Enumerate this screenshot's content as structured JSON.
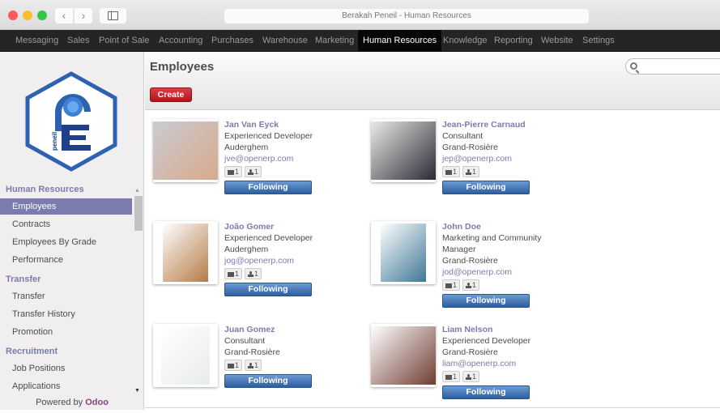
{
  "window": {
    "title": "Berakah Peneil - Human Resources",
    "back_glyph": "‹",
    "forward_glyph": "›"
  },
  "topmenu": {
    "items": [
      {
        "label": "Messaging"
      },
      {
        "label": "Sales"
      },
      {
        "label": "Point of Sale"
      },
      {
        "label": "Accounting"
      },
      {
        "label": "Purchases"
      },
      {
        "label": "Warehouse"
      },
      {
        "label": "Marketing"
      },
      {
        "label": "Human Resources",
        "active": true
      },
      {
        "label": "Knowledge"
      },
      {
        "label": "Reporting"
      },
      {
        "label": "Website"
      },
      {
        "label": "Settings"
      }
    ]
  },
  "sidebar": {
    "logo_text": "peneil",
    "sections": [
      {
        "title": "Human Resources",
        "items": [
          {
            "label": "Employees",
            "active": true
          },
          {
            "label": "Contracts"
          },
          {
            "label": "Employees By Grade"
          },
          {
            "label": "Performance"
          }
        ]
      },
      {
        "title": "Transfer",
        "items": [
          {
            "label": "Transfer"
          },
          {
            "label": "Transfer History"
          },
          {
            "label": "Promotion"
          }
        ]
      },
      {
        "title": "Recruitment",
        "items": [
          {
            "label": "Job Positions"
          },
          {
            "label": "Applications"
          }
        ]
      }
    ],
    "powered_by": "Powered by",
    "powered_brand": "Odoo",
    "scroll_up": "▲",
    "scroll_down": "▼"
  },
  "main": {
    "title": "Employees",
    "create_label": "Create",
    "search_placeholder": ""
  },
  "employees": [
    {
      "name": "Jan Van Eyck",
      "job": "Experienced Developer",
      "location": "Auderghem",
      "email": "jve@openerp.com",
      "messages": "1",
      "followers": "1",
      "follow_label": "Following"
    },
    {
      "name": "Jean-Pierre Carnaud",
      "job": "Consultant",
      "location": "Grand-Rosière",
      "email": "jep@openerp.com",
      "messages": "1",
      "followers": "1",
      "follow_label": "Following"
    },
    {
      "name": "João Gomer",
      "job": "Experienced Developer",
      "location": "Auderghem",
      "email": "jog@openerp.com",
      "messages": "1",
      "followers": "1",
      "follow_label": "Following"
    },
    {
      "name": "John Doe",
      "job": "Marketing and Community Manager",
      "location": "Grand-Rosière",
      "email": "jod@openerp.com",
      "messages": "1",
      "followers": "1",
      "follow_label": "Following"
    },
    {
      "name": "Juan Gomez",
      "job": "Consultant",
      "location": "Grand-Rosière",
      "email": "",
      "messages": "1",
      "followers": "1",
      "follow_label": "Following"
    },
    {
      "name": "Liam Nelson",
      "job": "Experienced Developer",
      "location": "Grand-Rosière",
      "email": "liam@openerp.com",
      "messages": "1",
      "followers": "1",
      "follow_label": "Following"
    }
  ],
  "colors": {
    "accent": "#7c7bad",
    "create": "#c4232a",
    "follow": "#3f6fb0",
    "topbar": "#252525"
  }
}
